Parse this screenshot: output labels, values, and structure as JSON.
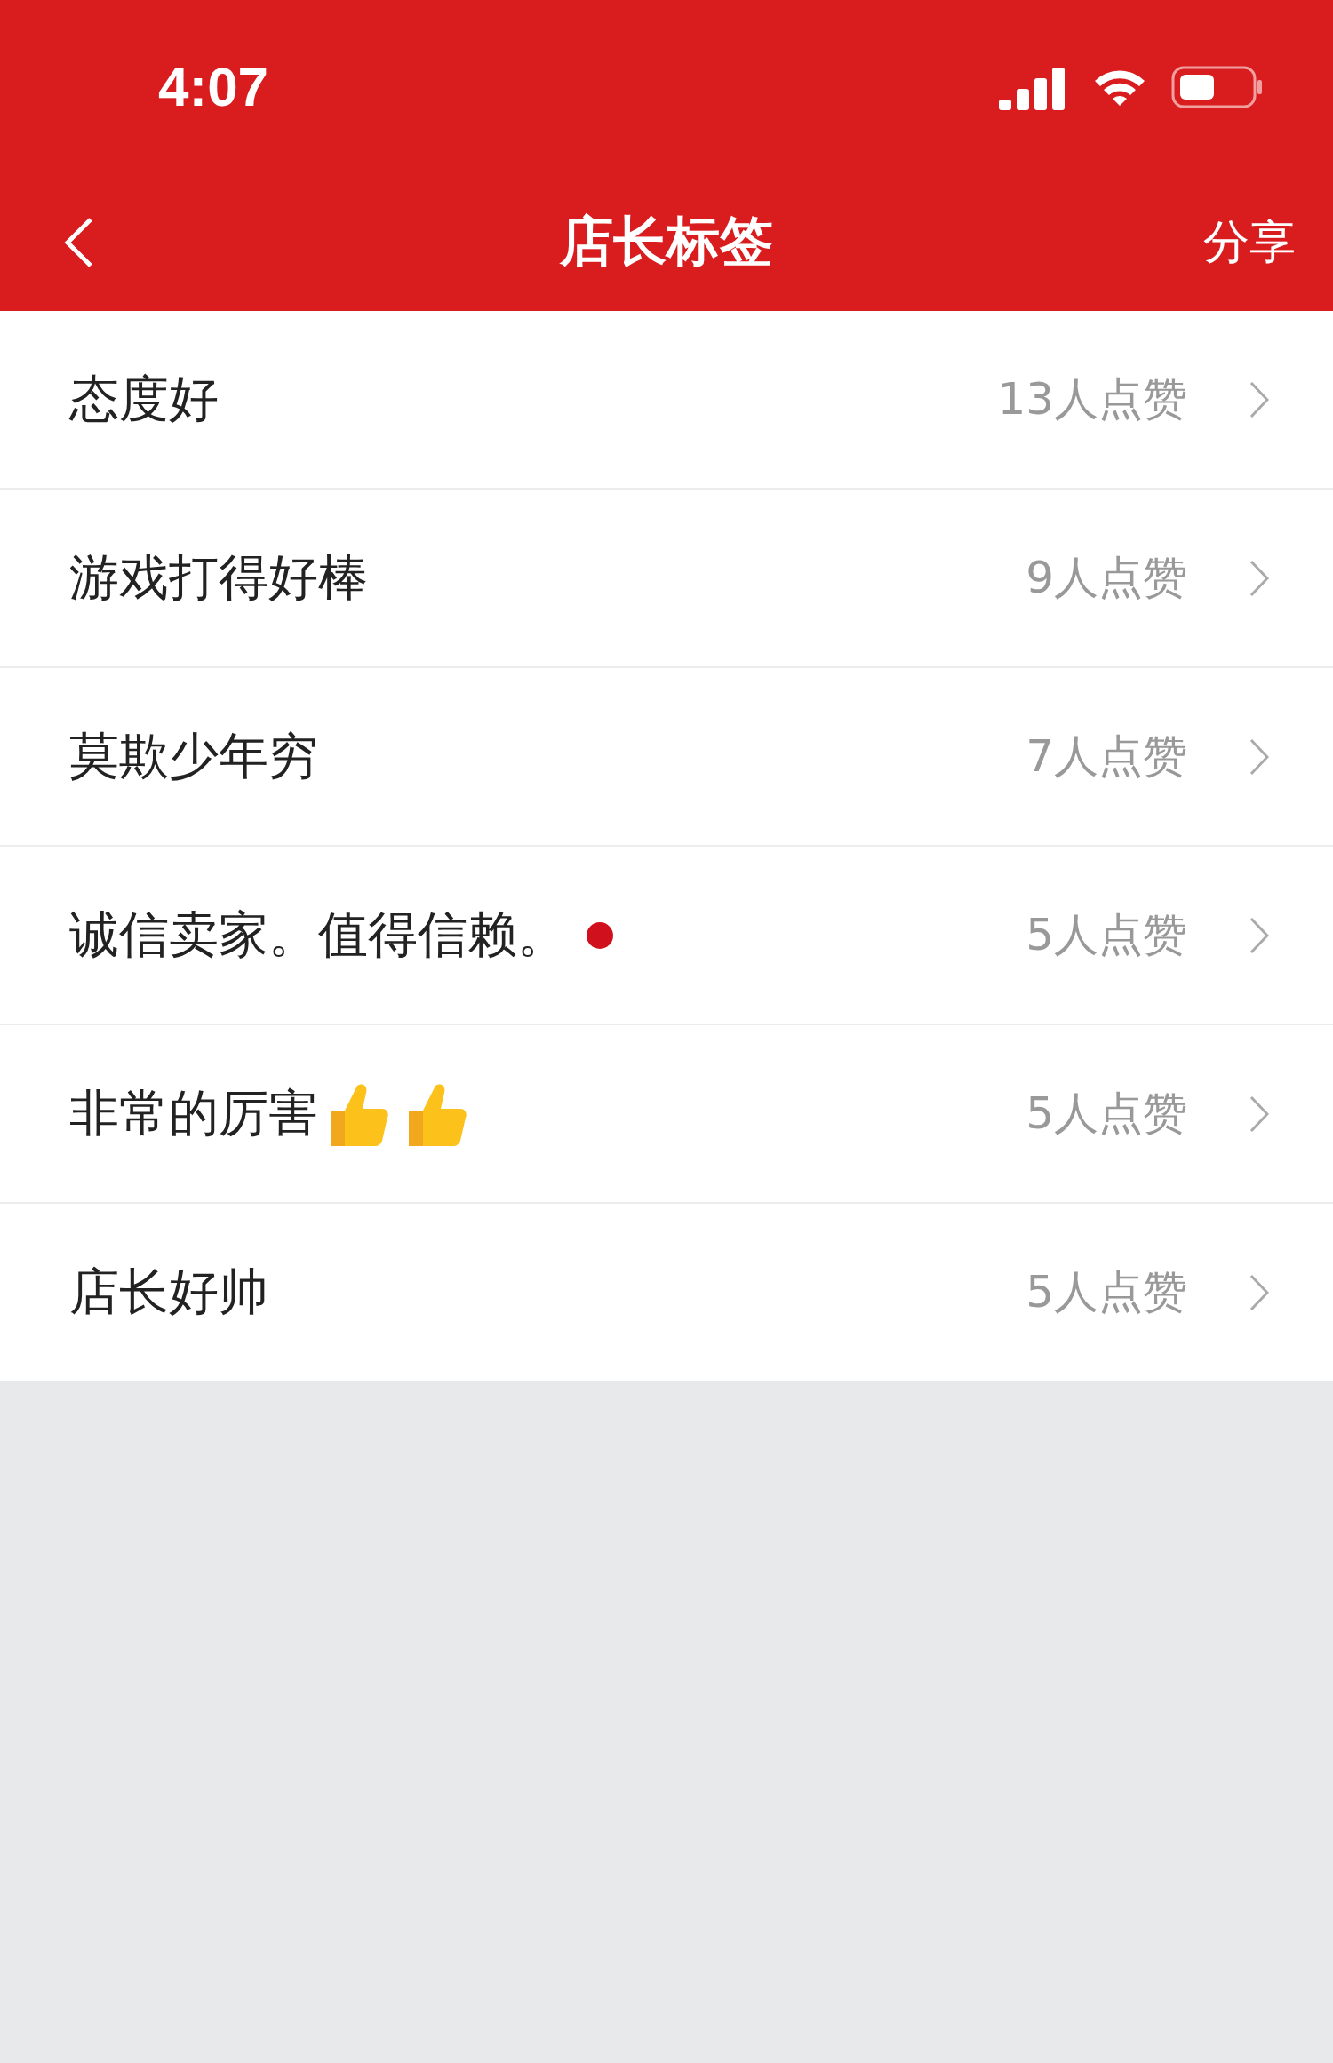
{
  "status_bar": {
    "time": "4:07"
  },
  "nav": {
    "title": "店长标签",
    "action": "分享"
  },
  "tags": [
    {
      "label": "态度好",
      "likes": "13人点赞",
      "dot": false
    },
    {
      "label": "游戏打得好棒",
      "likes": "9人点赞",
      "dot": false
    },
    {
      "label": "莫欺少年穷",
      "likes": "7人点赞",
      "dot": false
    },
    {
      "label": "诚信卖家。值得信赖。",
      "likes": "5人点赞",
      "dot": true
    },
    {
      "label": "非常的厉害",
      "likes": "5人点赞",
      "dot": false,
      "icons": [
        {
          "kind": "thumbs-up"
        },
        {
          "kind": "thumbs-up"
        }
      ]
    },
    {
      "label": "店长好帅",
      "likes": "5人点赞",
      "dot": false
    }
  ]
}
